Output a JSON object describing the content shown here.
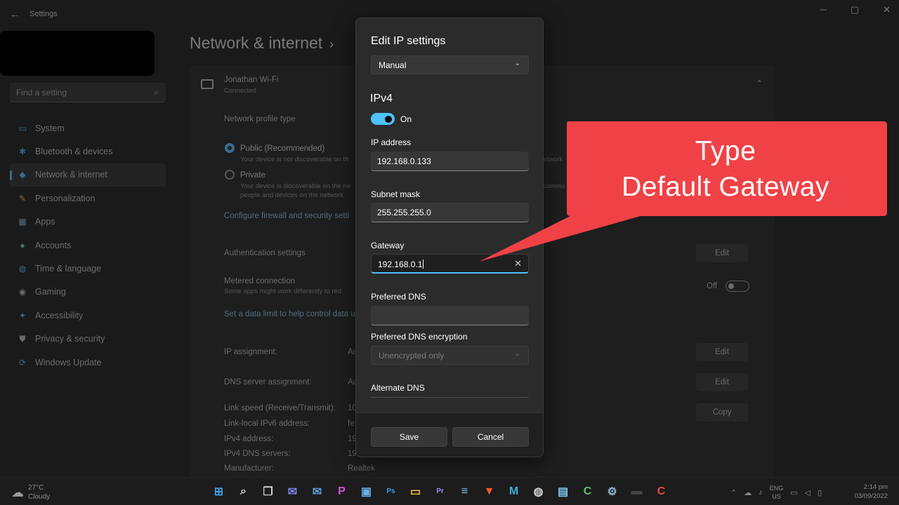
{
  "window": {
    "app_title": "Settings",
    "back_icon": "←",
    "minimize": "─",
    "maximize": "▢",
    "close": "✕"
  },
  "search": {
    "placeholder": "Find a setting",
    "icon": "⌕"
  },
  "sidebar": {
    "items": [
      {
        "label": "System",
        "icon": "monitor-icon",
        "glyph": "▭",
        "color": "#3d6a8c"
      },
      {
        "label": "Bluetooth & devices",
        "icon": "bluetooth-icon",
        "glyph": "✱",
        "color": "#2f5f86"
      },
      {
        "label": "Network & internet",
        "icon": "network-icon",
        "glyph": "◆",
        "color": "#3d6a8c",
        "active": true
      },
      {
        "label": "Personalization",
        "icon": "brush-icon",
        "glyph": "✎",
        "color": "#8a6a3d"
      },
      {
        "label": "Apps",
        "icon": "apps-icon",
        "glyph": "▦",
        "color": "#5a6c7c"
      },
      {
        "label": "Accounts",
        "icon": "person-icon",
        "glyph": "●",
        "color": "#3d7a5e"
      },
      {
        "label": "Time & language",
        "icon": "globe-icon",
        "glyph": "◍",
        "color": "#3d6a8c"
      },
      {
        "label": "Gaming",
        "icon": "controller-icon",
        "glyph": "◉",
        "color": "#6a6a6a"
      },
      {
        "label": "Accessibility",
        "icon": "accessibility-icon",
        "glyph": "✦",
        "color": "#3d6a8c"
      },
      {
        "label": "Privacy & security",
        "icon": "shield-icon",
        "glyph": "⛊",
        "color": "#6a6a6a"
      },
      {
        "label": "Windows Update",
        "icon": "update-icon",
        "glyph": "⟳",
        "color": "#3d6a8c"
      }
    ]
  },
  "page": {
    "title": "Network & internet",
    "chevron": "›",
    "wifi_name": "Jonathan Wi-Fi",
    "wifi_status": "Connected",
    "collapse_icon": "⌃",
    "profile_type_label": "Network profile type",
    "public_label": "Public (Recommended)",
    "public_desc": "Your device is not discoverable on th",
    "public_desc_right": "network",
    "private_label": "Private",
    "private_desc_1": "Your device is discoverable on the ne",
    "private_desc_2": "people and devices on the network.",
    "private_desc_right": "commu",
    "firewall_link": "Configure firewall and security setti",
    "auth_label": "Authentication settings",
    "metered_label": "Metered connection",
    "metered_desc": "Some apps might work differently to red",
    "metered_state": "Off",
    "data_limit_link": "Set a data limit to help control data u",
    "ip_assignment_label": "IP assignment:",
    "ip_assignment_value": "Au",
    "dns_assignment_label": "DNS server assignment:",
    "dns_assignment_value": "Au",
    "link_speed_label": "Link speed (Receive/Transmit):",
    "link_speed_value": "10",
    "ipv6_label": "Link-local IPv6 address:",
    "ipv6_value": "fe",
    "ipv4_label": "IPv4 address:",
    "ipv4_value": "19",
    "ipv4_dns_label": "IPv4 DNS servers:",
    "ipv4_dns_value": "19",
    "manufacturer_label": "Manufacturer:",
    "manufacturer_value": "Realtek",
    "edit_label": "Edit",
    "copy_label": "Copy"
  },
  "dialog": {
    "title": "Edit IP settings",
    "mode": "Manual",
    "dropdown_arrow": "⌄",
    "section": "IPv4",
    "toggle_state": "On",
    "ip_address": {
      "label": "IP address",
      "value": "192.168.0.133"
    },
    "subnet_mask": {
      "label": "Subnet mask",
      "value": "255.255.255.0"
    },
    "gateway": {
      "label": "Gateway",
      "value": "192.168.0.1",
      "clear_icon": "✕"
    },
    "preferred_dns": {
      "label": "Preferred DNS",
      "value": ""
    },
    "dns_encryption": {
      "label": "Preferred DNS encryption",
      "value": "Unencrypted only"
    },
    "alternate_dns": {
      "label": "Alternate DNS"
    },
    "save": "Save",
    "cancel": "Cancel"
  },
  "callout": {
    "line1": "Type",
    "line2": "Default Gateway",
    "color": "#f04246"
  },
  "taskbar": {
    "temperature": "27°C",
    "condition": "Cloudy",
    "apps": [
      {
        "name": "start-icon",
        "glyph": "⊞",
        "color": "#3aa0e8"
      },
      {
        "name": "search-icon",
        "glyph": "⌕",
        "color": "#cfcfcf"
      },
      {
        "name": "task-view-icon",
        "glyph": "❐",
        "color": "#cfcfcf"
      },
      {
        "name": "teams-chat-icon",
        "glyph": "✉",
        "color": "#7b83eb"
      },
      {
        "name": "mail-icon",
        "glyph": "✉",
        "color": "#5b9bd5"
      },
      {
        "name": "picsart-icon",
        "glyph": "P",
        "color": "#d94fdc"
      },
      {
        "name": "store-icon",
        "glyph": "▣",
        "color": "#6ab0e8"
      },
      {
        "name": "photoshop-icon",
        "glyph": "Ps",
        "color": "#3d9be9"
      },
      {
        "name": "file-explorer-icon",
        "glyph": "▭",
        "color": "#f4c542"
      },
      {
        "name": "premiere-icon",
        "glyph": "Pr",
        "color": "#9a8cff"
      },
      {
        "name": "notepad-icon",
        "glyph": "≡",
        "color": "#7ec6f2"
      },
      {
        "name": "brave-icon",
        "glyph": "▼",
        "color": "#f25a29"
      },
      {
        "name": "maxthon-icon",
        "glyph": "M",
        "color": "#3ab3d9"
      },
      {
        "name": "network-globe-icon",
        "glyph": "◍",
        "color": "#cfcfcf"
      },
      {
        "name": "calculator-icon",
        "glyph": "▤",
        "color": "#7ec6f2"
      },
      {
        "name": "camtasia-icon",
        "glyph": "C",
        "color": "#5ec26a"
      },
      {
        "name": "settings-icon",
        "glyph": "⚙",
        "color": "#8ab4d4"
      },
      {
        "name": "terminal-icon",
        "glyph": "▬",
        "color": "#444444"
      },
      {
        "name": "recorder-icon",
        "glyph": "C",
        "color": "#e8483c"
      }
    ],
    "tray_chevron": "⌃",
    "lang_1": "ENG",
    "lang_2": "US",
    "time": "2:14 pm",
    "date": "03/09/2022"
  }
}
